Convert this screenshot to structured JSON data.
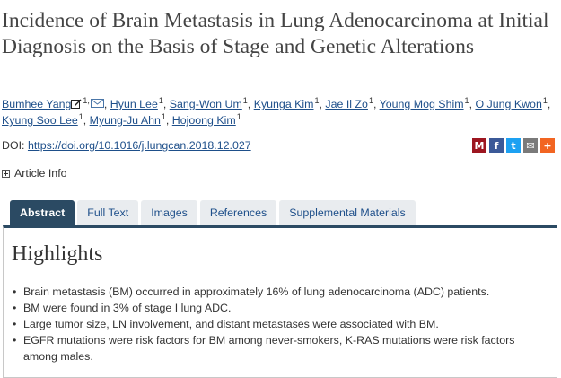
{
  "article": {
    "title": "Incidence of Brain Metastasis in Lung Adenocarcinoma at Initial Diagnosis on the Basis of Stage and Genetic Alterations"
  },
  "authors": [
    {
      "name": "Bumhee Yang",
      "sup": "1,",
      "corresponding": true
    },
    {
      "name": "Hyun Lee",
      "sup": "1"
    },
    {
      "name": "Sang-Won Um",
      "sup": "1"
    },
    {
      "name": "Kyunga Kim",
      "sup": "1"
    },
    {
      "name": "Jae Il Zo",
      "sup": "1"
    },
    {
      "name": "Young Mog Shim",
      "sup": "1"
    },
    {
      "name": "O Jung Kwon",
      "sup": "1"
    },
    {
      "name": "Kyung Soo Lee",
      "sup": "1"
    },
    {
      "name": "Myung-Ju Ahn",
      "sup": "1"
    },
    {
      "name": "Hojoong Kim",
      "sup": "1"
    }
  ],
  "doi": {
    "label": "DOI:",
    "link": "https://doi.org/10.1016/j.lungcan.2018.12.027"
  },
  "share": [
    {
      "icon": "mendeley-icon",
      "glyph": "M",
      "color": "#9d1620"
    },
    {
      "icon": "facebook-icon",
      "glyph": "f",
      "color": "#3b5998"
    },
    {
      "icon": "twitter-icon",
      "glyph": "t",
      "color": "#1da1f2"
    },
    {
      "icon": "email-icon",
      "glyph": "✉",
      "color": "#7a7a7a"
    },
    {
      "icon": "more-share-icon",
      "glyph": "+",
      "color": "#f26522"
    }
  ],
  "article_info": {
    "label": "Article Info"
  },
  "tabs": [
    {
      "label": "Abstract",
      "active": true
    },
    {
      "label": "Full Text"
    },
    {
      "label": "Images"
    },
    {
      "label": "References"
    },
    {
      "label": "Supplemental Materials"
    }
  ],
  "highlights": {
    "title": "Highlights",
    "items": [
      "Brain metastasis (BM) occurred in approximately 16% of lung adenocarcinoma (ADC) patients.",
      "BM were found in 3% of stage I lung ADC.",
      "Large tumor size, LN involvement, and distant metastases were associated with BM.",
      "EGFR mutations were risk factors for BM among never-smokers, K-RAS mutations were risk factors among males."
    ]
  }
}
